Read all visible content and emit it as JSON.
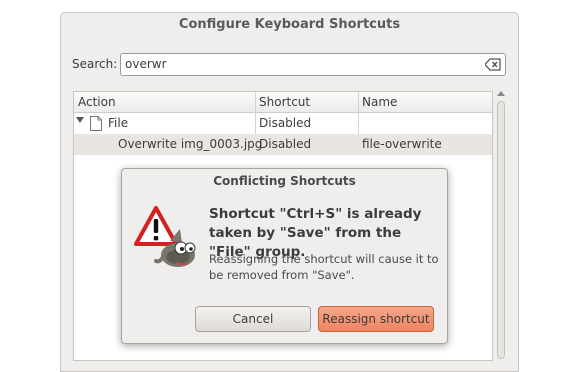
{
  "window": {
    "title": "Configure Keyboard Shortcuts"
  },
  "search": {
    "label": "Search:",
    "value": "overwr"
  },
  "table": {
    "columns": [
      "Action",
      "Shortcut",
      "Name"
    ],
    "rows": [
      {
        "action": "File",
        "shortcut": "Disabled",
        "name": ""
      },
      {
        "action": "Overwrite img_0003.jpg",
        "shortcut": "Disabled",
        "name": "file-overwrite"
      }
    ]
  },
  "dialog": {
    "title": "Conflicting Shortcuts",
    "heading": "Shortcut \"Ctrl+S\" is already taken by \"Save\" from the \"File\" group.",
    "body": "Reassigning the shortcut will cause it to be removed from \"Save\".",
    "cancel_label": "Cancel",
    "reassign_label": "Reassign shortcut",
    "icon": "warning-icon"
  },
  "colors": {
    "accent": "#ef8562",
    "warning_red": "#d42020"
  }
}
